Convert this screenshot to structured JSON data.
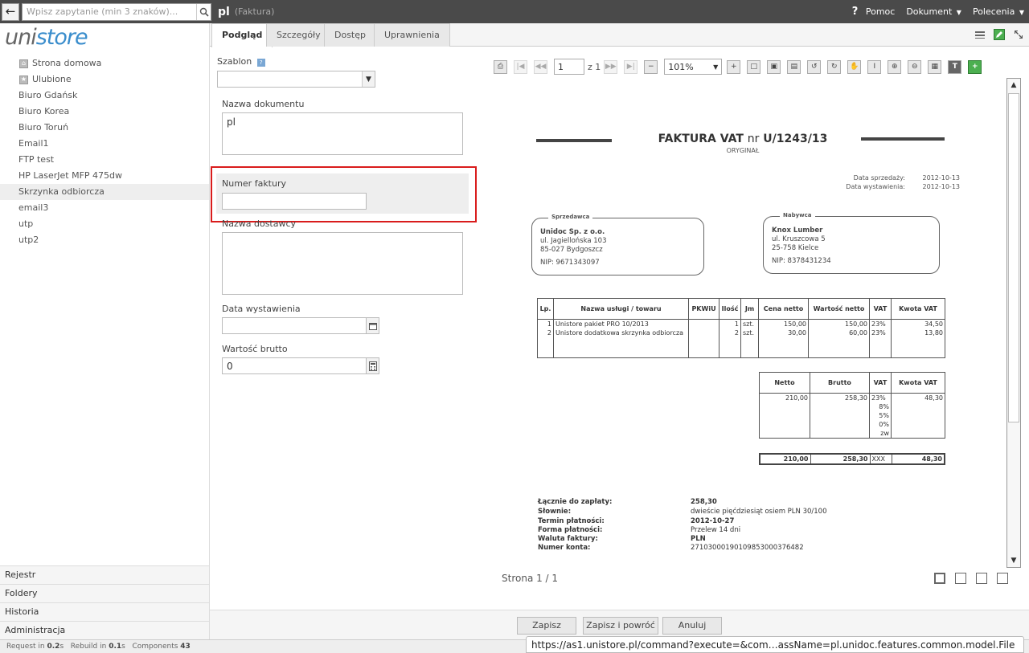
{
  "topbar": {
    "search_placeholder": "Wpisz zapytanie (min 3 znaków)...",
    "doc_title": "pl",
    "doc_type": "(Faktura)",
    "help": "Pomoc",
    "document_menu": "Dokument",
    "commands_menu": "Polecenia"
  },
  "logo": {
    "part1": "uni",
    "part2": "store"
  },
  "sidebar": {
    "items": [
      {
        "label": "Strona domowa",
        "icon": "home-icon"
      },
      {
        "label": "Ulubione",
        "icon": "star-icon"
      },
      {
        "label": "Biuro Gdańsk"
      },
      {
        "label": "Biuro Korea"
      },
      {
        "label": "Biuro Toruń"
      },
      {
        "label": "Email1"
      },
      {
        "label": "FTP test"
      },
      {
        "label": "HP LaserJet MFP 475dw"
      },
      {
        "label": "Skrzynka odbiorcza"
      },
      {
        "label": "email3"
      },
      {
        "label": "utp"
      },
      {
        "label": "utp2"
      }
    ],
    "sections": [
      "Rejestr",
      "Foldery",
      "Historia",
      "Administracja"
    ]
  },
  "tabs": [
    "Podgląd",
    "Szczegóły",
    "Dostęp",
    "Uprawnienia"
  ],
  "form": {
    "template_label": "Szablon",
    "template_value": "",
    "doc_name_label": "Nazwa dokumentu",
    "doc_name_value": "pl",
    "invoice_number_label": "Numer faktury",
    "invoice_number_value": "",
    "supplier_label": "Nazwa dostawcy",
    "supplier_value": "",
    "issue_date_label": "Data wystawienia",
    "issue_date_value": "",
    "gross_label": "Wartość brutto",
    "gross_value": "0"
  },
  "viewer": {
    "page_input": "1",
    "page_of": "z 1",
    "zoom": "101%",
    "page_counter": "Strona 1 / 1"
  },
  "invoice": {
    "title": "FAKTURA VAT",
    "nr_word": "nr",
    "number": "U/1243/13",
    "subtitle": "ORYGINAŁ",
    "sale_date_label": "Data sprzedaży:",
    "sale_date": "2012-10-13",
    "issue_date_label": "Data wystawienia:",
    "issue_date": "2012-10-13",
    "seller": {
      "label": "Sprzedawca",
      "name": "Unidoc Sp. z o.o.",
      "street": "ul. Jagiellońska 103",
      "city": "85-027 Bydgoszcz",
      "nip": "NIP: 9671343097"
    },
    "buyer": {
      "label": "Nabywca",
      "name": "Knox Lumber",
      "street": "ul. Kruszcowa 5",
      "city": "25-758 Kielce",
      "nip": "NIP: 8378431234"
    },
    "items_headers": [
      "Lp.",
      "Nazwa usługi / towaru",
      "PKWiU",
      "Ilość",
      "Jm",
      "Cena netto",
      "Wartość netto",
      "VAT",
      "Kwota VAT"
    ],
    "items": [
      {
        "lp": "1",
        "name": "Unistore pakiet PRO 10/2013",
        "pkwiu": "",
        "qty": "1",
        "unit": "szt.",
        "price": "150,00",
        "net": "150,00",
        "vat": "23%",
        "vat_amount": "34,50"
      },
      {
        "lp": "2",
        "name": "Unistore dodatkowa skrzynka odbiorcza",
        "pkwiu": "",
        "qty": "2",
        "unit": "szt.",
        "price": "30,00",
        "net": "60,00",
        "vat": "23%",
        "vat_amount": "13,80"
      }
    ],
    "summary_headers": [
      "Netto",
      "Brutto",
      "VAT",
      "Kwota VAT"
    ],
    "summary_rows": [
      {
        "net": "210,00",
        "gross": "258,30",
        "vat": "23%",
        "vat_amount": "48,30"
      },
      {
        "net": "",
        "gross": "",
        "vat": "8%",
        "vat_amount": ""
      },
      {
        "net": "",
        "gross": "",
        "vat": "5%",
        "vat_amount": ""
      },
      {
        "net": "",
        "gross": "",
        "vat": "0%",
        "vat_amount": ""
      },
      {
        "net": "",
        "gross": "",
        "vat": "zw",
        "vat_amount": ""
      }
    ],
    "summary_total": {
      "net": "210,00",
      "gross": "258,30",
      "vat": "XXX",
      "vat_amount": "48,30"
    },
    "payment": [
      {
        "key": "Łącznie do zapłaty:",
        "value": "258,30"
      },
      {
        "key": "Słownie:",
        "value": "dwieście pięćdziesiąt osiem PLN 30/100"
      },
      {
        "key": "Termin płatności:",
        "value": "2012-10-27"
      },
      {
        "key": "Forma płatności:",
        "value": "Przelew 14 dni"
      },
      {
        "key": "Waluta faktury:",
        "value": "PLN"
      },
      {
        "key": "Numer konta:",
        "value": "27103000190109853000376482"
      }
    ]
  },
  "buttons": {
    "save": "Zapisz",
    "save_return": "Zapisz i powróć",
    "cancel": "Anuluj"
  },
  "statusbar": {
    "request_label": "Request in",
    "request_val": "0.2",
    "rebuild_label": "Rebuild in",
    "rebuild_val": "0.1",
    "components_label": "Components",
    "components_val": "43",
    "unit": "s"
  },
  "url_tooltip": "https://as1.unistore.pl/command?execute=&com…assName=pl.unidoc.features.common.model.File",
  "colors": {
    "topbar": "#4a4a4a",
    "accent": "#3a8dcc",
    "highlight": "#d91c1c"
  }
}
